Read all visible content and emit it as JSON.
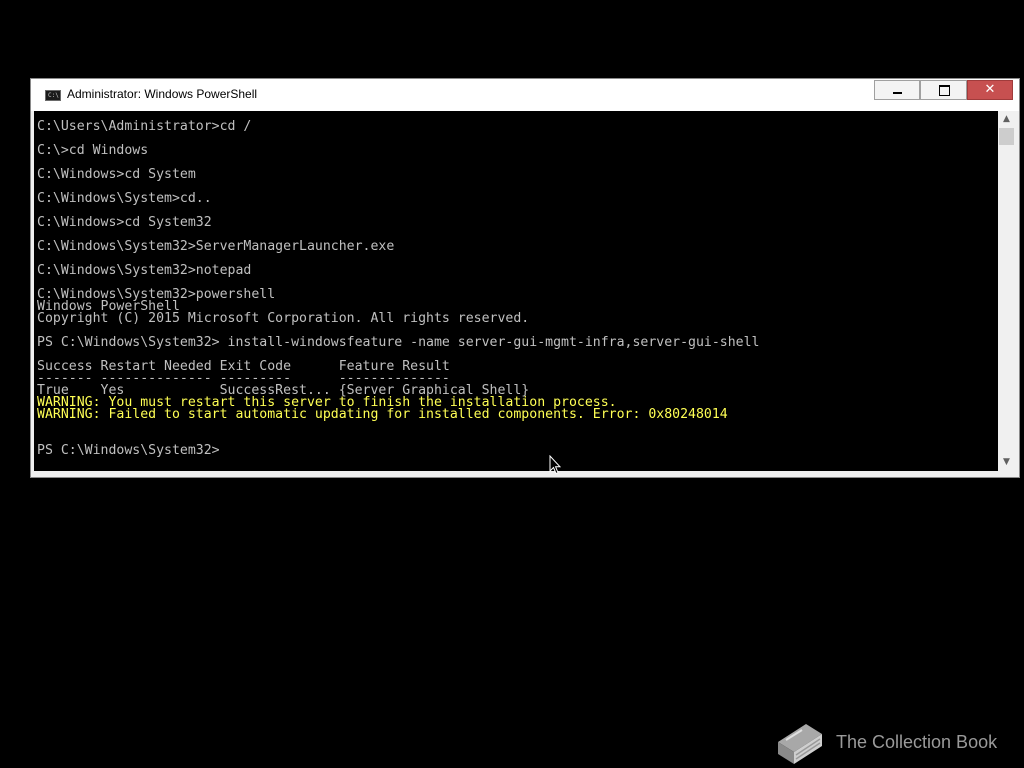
{
  "window": {
    "title": "Administrator: Windows PowerShell",
    "icon_glyph": "C:\\",
    "controls": {
      "minimize": "minimize-icon",
      "maximize": "maximize-icon",
      "close": "close-icon",
      "close_glyph": "✕"
    },
    "colors": {
      "console_background": "#000000",
      "console_text": "#c0c0c0",
      "warning_text": "#ffff54",
      "close_button": "#c75050"
    }
  },
  "console": {
    "lines": [
      "C:\\Users\\Administrator>cd /",
      "",
      "C:\\>cd Windows",
      "",
      "C:\\Windows>cd System",
      "",
      "C:\\Windows\\System>cd..",
      "",
      "C:\\Windows>cd System32",
      "",
      "C:\\Windows\\System32>ServerManagerLauncher.exe",
      "",
      "C:\\Windows\\System32>notepad",
      "",
      "C:\\Windows\\System32>powershell",
      "Windows PowerShell",
      "Copyright (C) 2015 Microsoft Corporation. All rights reserved.",
      "",
      "PS C:\\Windows\\System32> install-windowsfeature -name server-gui-mgmt-infra,server-gui-shell",
      "",
      "Success Restart Needed Exit Code      Feature Result",
      "------- -------------- ---------      --------------",
      "True    Yes            SuccessRest... {Server Graphical Shell}",
      "WARNING: You must restart this server to finish the installation process.",
      "WARNING: Failed to start automatic updating for installed components. Error: 0x80248014",
      "",
      "",
      "PS C:\\Windows\\System32>"
    ]
  },
  "scrollbar": {
    "up_icon": "scroll-up-arrow-icon",
    "down_icon": "scroll-down-arrow-icon",
    "up_glyph": "▲",
    "down_glyph": "▼"
  },
  "cursor": {
    "icon": "mouse-pointer-icon"
  },
  "watermark": {
    "text": "The Collection Book",
    "icon": "book-icon"
  }
}
